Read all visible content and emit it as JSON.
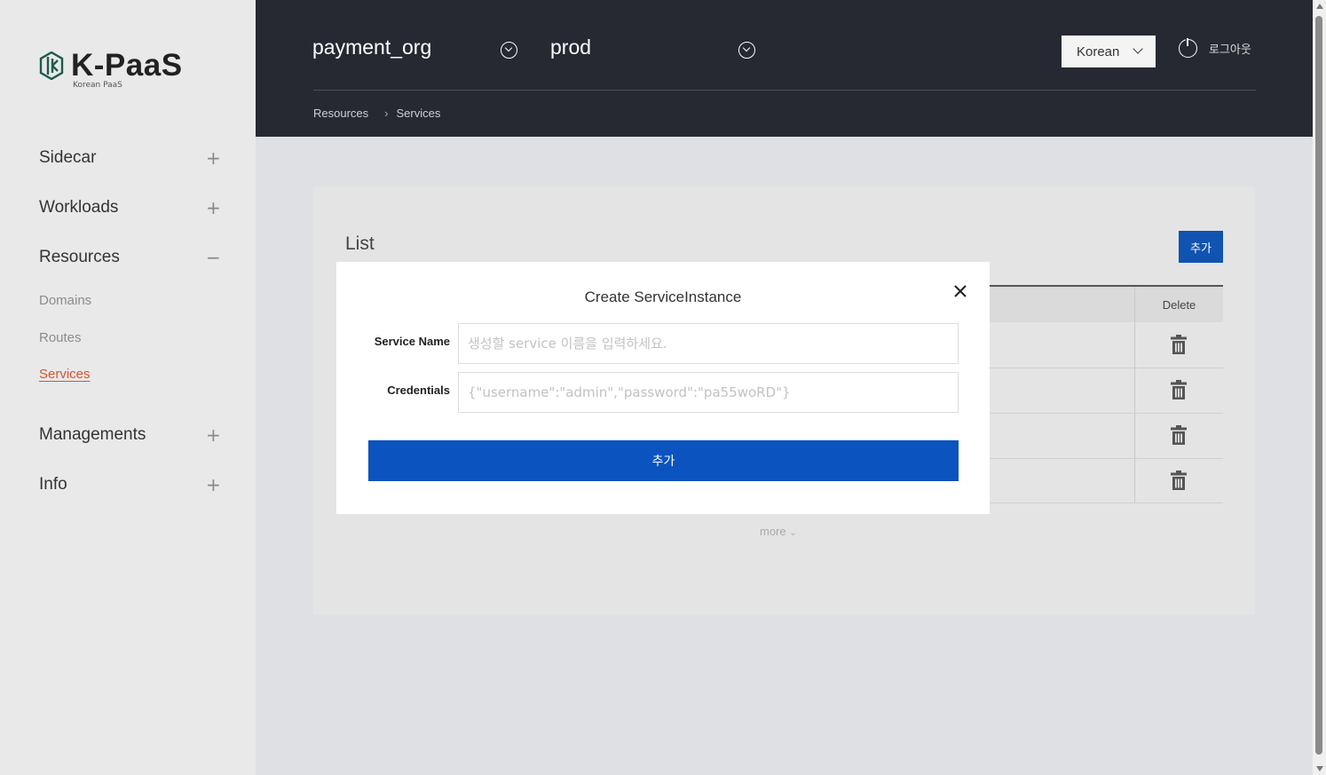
{
  "sidebar": {
    "logo": {
      "title": "K-PaaS",
      "subtitle": "Korean PaaS"
    },
    "nav": [
      {
        "label": "Sidecar",
        "toggle": "+"
      },
      {
        "label": "Workloads",
        "toggle": "+"
      },
      {
        "label": "Resources",
        "toggle": "−"
      },
      {
        "label": "Managements",
        "toggle": "+"
      },
      {
        "label": "Info",
        "toggle": "+"
      }
    ],
    "resources_sub": [
      {
        "label": "Domains"
      },
      {
        "label": "Routes"
      },
      {
        "label": "Services",
        "active": true
      }
    ],
    "active_color": "#d9532b"
  },
  "header": {
    "org": "payment_org",
    "space": "prod",
    "language": "Korean",
    "logout": "로그아웃",
    "breadcrumb": [
      "Resources",
      "Services"
    ]
  },
  "list": {
    "title": "List",
    "add_label": "추가",
    "delete_header": "Delete",
    "row_count": 4,
    "more_label": "more"
  },
  "modal": {
    "title": "Create ServiceInstance",
    "service_name_label": "Service Name",
    "service_name_placeholder": "생성할 service 이름을 입력하세요.",
    "credentials_label": "Credentials",
    "credentials_placeholder": "{\"username\":\"admin\",\"password\":\"pa55woRD\"}",
    "submit_label": "추가"
  },
  "colors": {
    "header_bg": "#262932",
    "primary_button": "#0b53be",
    "sidebar_bg": "#e9e9ea"
  }
}
